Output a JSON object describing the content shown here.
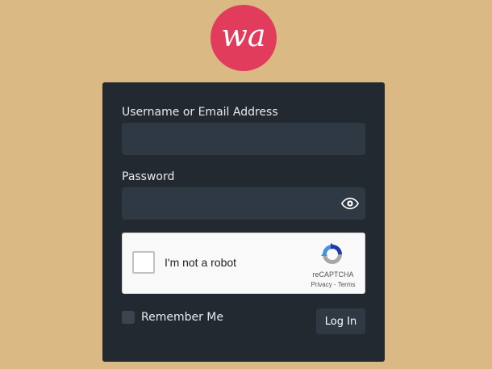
{
  "logo": {
    "text": "wa",
    "color": "#e13c5c"
  },
  "form": {
    "username_label": "Username or Email Address",
    "username_value": "",
    "password_label": "Password",
    "password_value": "",
    "remember_label": "Remember Me",
    "login_label": "Log In"
  },
  "captcha": {
    "label": "I'm not a robot",
    "brand": "reCAPTCHA",
    "privacy": "Privacy",
    "separator": " - ",
    "terms": "Terms"
  },
  "colors": {
    "background": "#dbb985",
    "card": "#222931",
    "input": "#2e3944"
  }
}
